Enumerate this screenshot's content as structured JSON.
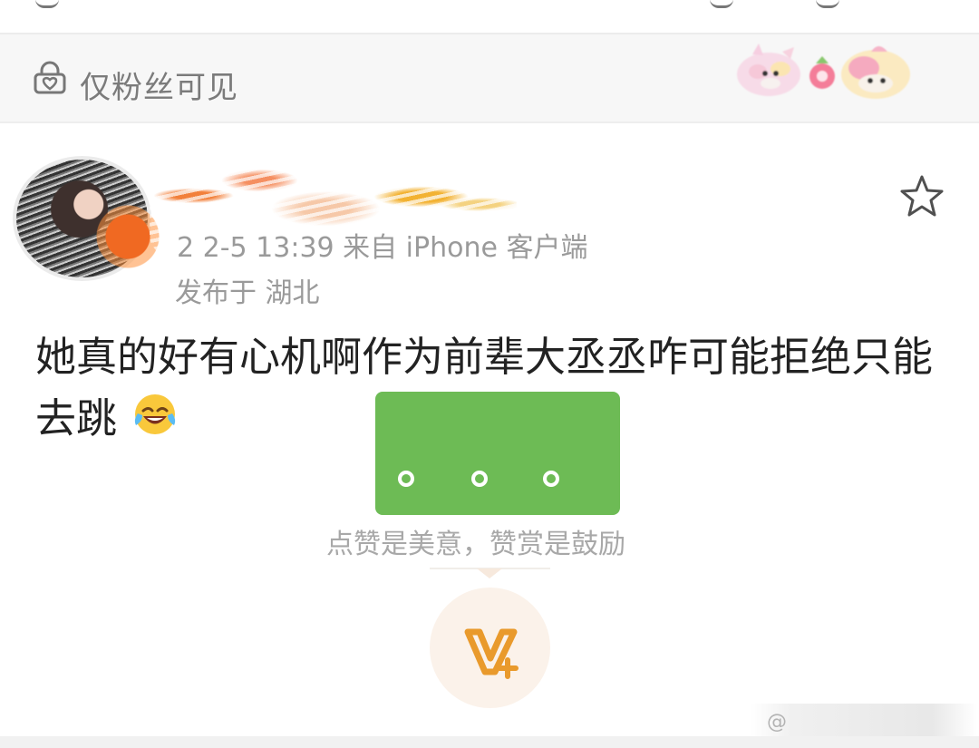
{
  "visibility": {
    "label": "仅粉丝可见",
    "icon": "lock-heart-icon"
  },
  "post": {
    "timestamp": "2 2-5 13:39 来自 iPhone 客户端",
    "location": "发布于 湖北",
    "content_line_1": "她真的好有心机啊作为前辈大丞丞咋可能拒绝只能",
    "content_line_2": "去跳",
    "emoji": "laughing-crying-emoji",
    "favorite_icon": "star-outline-icon"
  },
  "reward": {
    "text": "点赞是美意，赞赏是鼓励",
    "button_icon": "v-plus-icon"
  },
  "watermark": {
    "text": "@"
  },
  "colors": {
    "accent_orange": "#e99a2c",
    "green_block": "#6dbb55",
    "muted_text": "#9a9a9a"
  }
}
